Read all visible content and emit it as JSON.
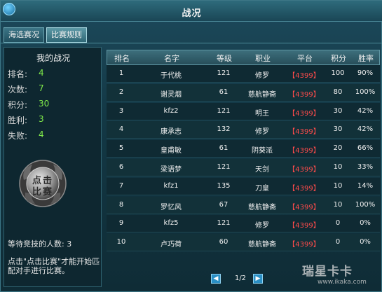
{
  "window": {
    "title": "战况"
  },
  "tabs": [
    {
      "label": "海选赛况",
      "active": false
    },
    {
      "label": "比赛规则",
      "active": true
    }
  ],
  "my_record": {
    "title": "我的战况",
    "stats": [
      {
        "label": "排名:",
        "value": "4"
      },
      {
        "label": "次数:",
        "value": "7"
      },
      {
        "label": "积分:",
        "value": "30"
      },
      {
        "label": "胜利:",
        "value": "3"
      },
      {
        "label": "失败:",
        "value": "4"
      }
    ],
    "emblem_line1": "点击",
    "emblem_line2": "比赛",
    "waiting_text": "等待竞技的人数: 3",
    "hint_text": "点击\"点击比赛\"才能开始匹配对手进行比赛。"
  },
  "table": {
    "headers": [
      "排名",
      "名字",
      "等级",
      "职业",
      "平台",
      "积分",
      "胜率"
    ],
    "rows": [
      [
        "1",
        "于代桃",
        "121",
        "修罗",
        "【4399】",
        "100",
        "90%"
      ],
      [
        "2",
        "谢灵烟",
        "61",
        "慈航静斋",
        "【4399】",
        "80",
        "100%"
      ],
      [
        "3",
        "kfz2",
        "121",
        "明王",
        "【4399】",
        "30",
        "42%"
      ],
      [
        "4",
        "康承志",
        "132",
        "修罗",
        "【4399】",
        "30",
        "42%"
      ],
      [
        "5",
        "皇甫敏",
        "61",
        "阴葵派",
        "【4399】",
        "20",
        "66%"
      ],
      [
        "6",
        "梁语梦",
        "121",
        "天剑",
        "【4399】",
        "10",
        "33%"
      ],
      [
        "7",
        "kfz1",
        "135",
        "刀皇",
        "【4399】",
        "10",
        "14%"
      ],
      [
        "8",
        "罗忆风",
        "67",
        "慈航静斋",
        "【4399】",
        "10",
        "100%"
      ],
      [
        "9",
        "kfz5",
        "121",
        "修罗",
        "【4399】",
        "0",
        "0%"
      ],
      [
        "10",
        "卢巧荷",
        "60",
        "慈航静斋",
        "【4399】",
        "0",
        "0%"
      ]
    ]
  },
  "pager": {
    "page": "1/2"
  },
  "watermark": {
    "line1": "瑞星卡卡",
    "line2": "www.ikaka.com"
  },
  "colors": {
    "stat_value": "#7fe84a",
    "platform": "#ff4b4b"
  },
  "icons": {
    "prev": "triangle-left-icon",
    "next": "triangle-right-icon",
    "emblem": "dragon-emblem-icon"
  }
}
